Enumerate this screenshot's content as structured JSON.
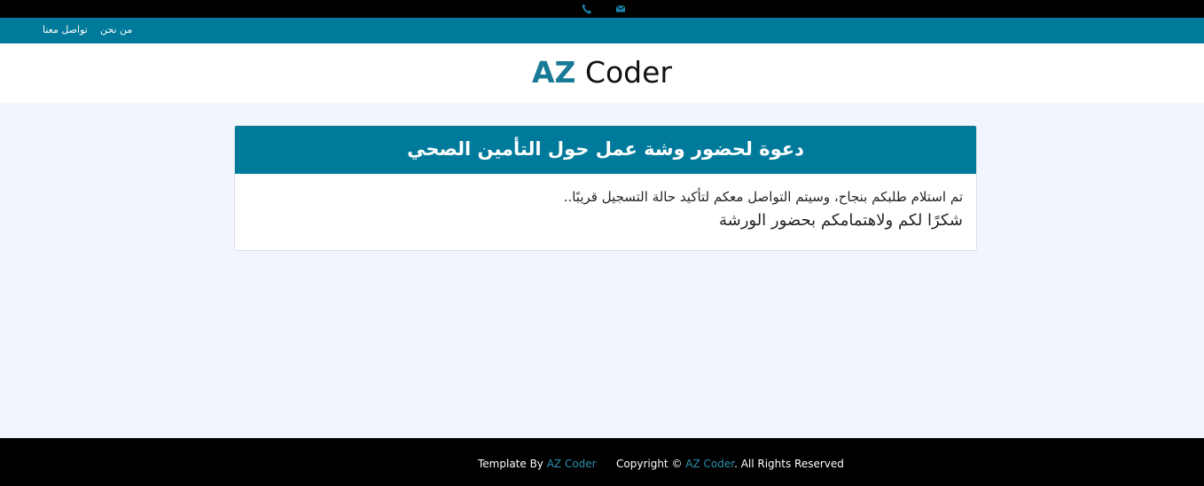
{
  "topbar": {
    "icons": [
      "phone-icon",
      "mail-icon"
    ]
  },
  "nav": {
    "contact_label": "تواصل معنا",
    "about_label": "من نحن"
  },
  "brand": {
    "az": "AZ",
    "rest": "Coder"
  },
  "card": {
    "title": "دعوة لحضور وشة عمل حول التأمين الصحي",
    "line1": "تم استلام طلبكم بنجاح، وسيتم التواصل معكم لتأكيد حالة التسجيل قريبًا..",
    "line2": "شكرًا لكم ولاهتمامكم بحضور الورشة"
  },
  "footer": {
    "template_prefix": "Template By ",
    "template_link": "AZ Coder",
    "copyright_prefix": "Copyright © ",
    "copyright_link": "AZ Coder",
    "copyright_suffix": ". All Rights Reserved"
  },
  "colors": {
    "primary": "#007a9b",
    "brand_accent": "#177a96",
    "link": "#2d8fb0",
    "background": "#f1f5fd",
    "bar": "#000000"
  }
}
